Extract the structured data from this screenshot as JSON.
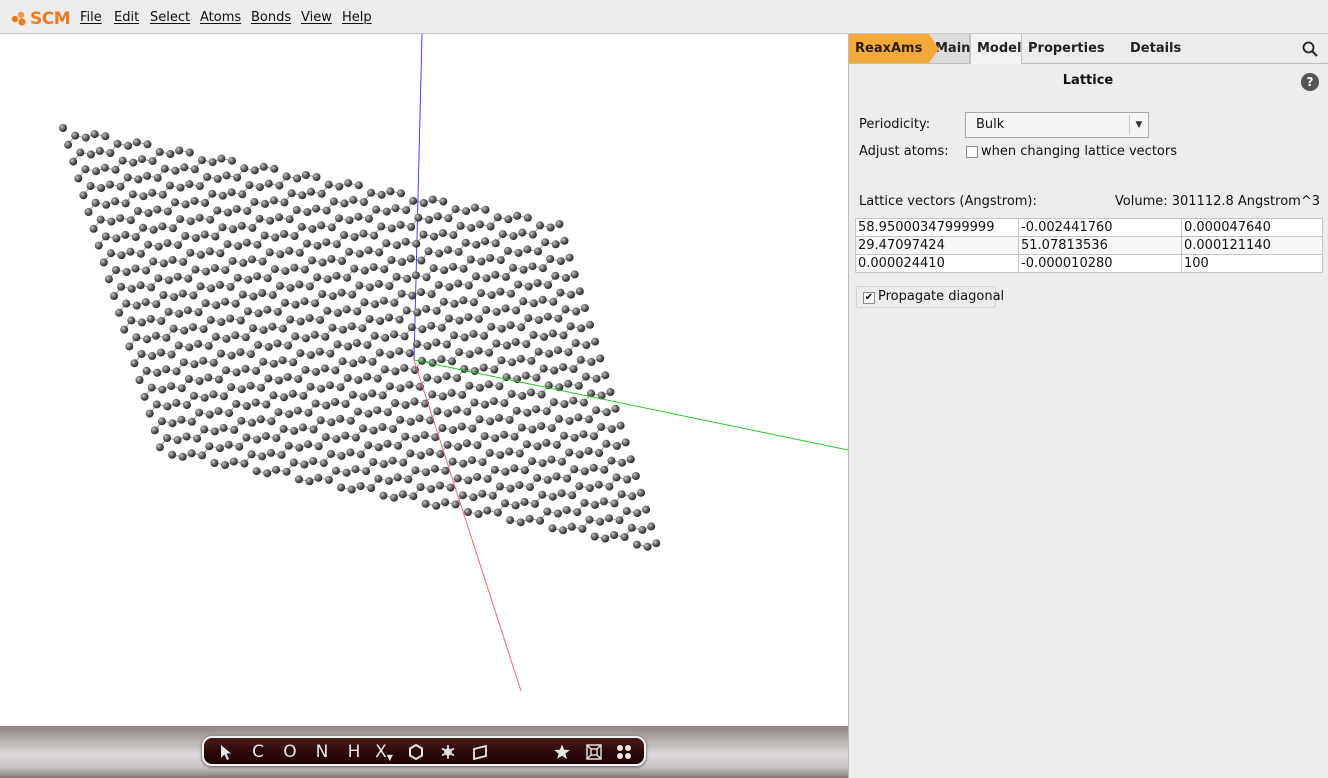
{
  "app": {
    "logo_text": "SCM",
    "brand_color": "#ee7b1e"
  },
  "menu": {
    "items": [
      "File",
      "Edit",
      "Select",
      "Atoms",
      "Bonds",
      "View",
      "Help"
    ]
  },
  "viewport": {
    "background": "#ffffff",
    "axis_colors": {
      "x": "#ff6666",
      "y": "#22cc22",
      "z": "#4444ff"
    },
    "atom_color": "#555555"
  },
  "toolbar": {
    "tools": [
      {
        "name": "select-tool",
        "icon": "pointer-icon"
      },
      {
        "name": "carbon-tool",
        "label": "C"
      },
      {
        "name": "oxygen-tool",
        "label": "O"
      },
      {
        "name": "nitrogen-tool",
        "label": "N"
      },
      {
        "name": "hydrogen-tool",
        "label": "H"
      },
      {
        "name": "element-picker-tool",
        "label": "X"
      },
      {
        "name": "ring-tool",
        "icon": "hexagon-icon"
      },
      {
        "name": "freeze-tool",
        "icon": "snowflake-icon"
      },
      {
        "name": "plane-tool",
        "icon": "plane-icon"
      },
      {
        "name": "favorites-tool",
        "icon": "star-icon"
      },
      {
        "name": "view-box-tool",
        "icon": "box-icon"
      },
      {
        "name": "more-tools",
        "icon": "dots-grid-icon"
      }
    ]
  },
  "panel": {
    "tabs": [
      "ReaxAms",
      "Main",
      "Model",
      "Properties",
      "Details"
    ],
    "active_tab": "Model",
    "accent_color": "#f4a83a",
    "section_title": "Lattice",
    "help_label": "?",
    "periodicity_label": "Periodicity:",
    "periodicity_value": "Bulk",
    "adjust_atoms_label": "Adjust atoms:",
    "adjust_atoms_option": "when changing lattice vectors",
    "adjust_atoms_checked": false,
    "lattice_vectors_label": "Lattice vectors (Angstrom):",
    "volume_text": "Volume: 301112.8 Angstrom^3",
    "lattice_vectors": [
      [
        "58.95000347999999",
        "-0.002441760",
        "0.000047640"
      ],
      [
        "29.47097424",
        "51.07813536",
        "0.000121140"
      ],
      [
        "0.000024410",
        "-0.000010280",
        "100"
      ]
    ],
    "propagate_label": "Propagate diagonal",
    "propagate_checked": true
  }
}
